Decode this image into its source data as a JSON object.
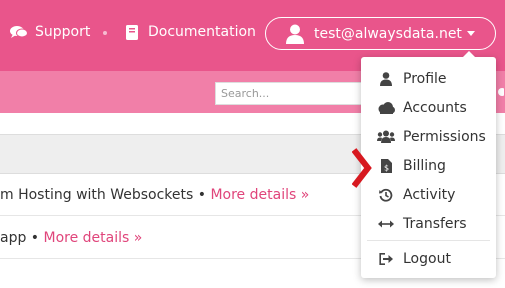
{
  "header": {
    "support_label": "Support",
    "documentation_label": "Documentation",
    "account_email": "test@alwaysdata.net"
  },
  "search": {
    "placeholder": "Search..."
  },
  "content": {
    "row1_text": "m Hosting with Websockets • ",
    "row1_link": "More details »",
    "row2_text": "app • ",
    "row2_link": "More details »"
  },
  "menu": {
    "items": [
      {
        "label": "Profile",
        "icon": "user-icon"
      },
      {
        "label": "Accounts",
        "icon": "cloud-icon"
      },
      {
        "label": "Permissions",
        "icon": "users-icon"
      },
      {
        "label": "Billing",
        "icon": "invoice-icon"
      },
      {
        "label": "Activity",
        "icon": "history-icon"
      },
      {
        "label": "Transfers",
        "icon": "arrows-h-icon"
      },
      {
        "label": "Logout",
        "icon": "sign-out-icon"
      }
    ]
  },
  "colors": {
    "brand_pink": "#e9558b",
    "band_pink": "#f17fa8",
    "link_pink": "#e0457b",
    "pointer_red": "#d71920"
  }
}
